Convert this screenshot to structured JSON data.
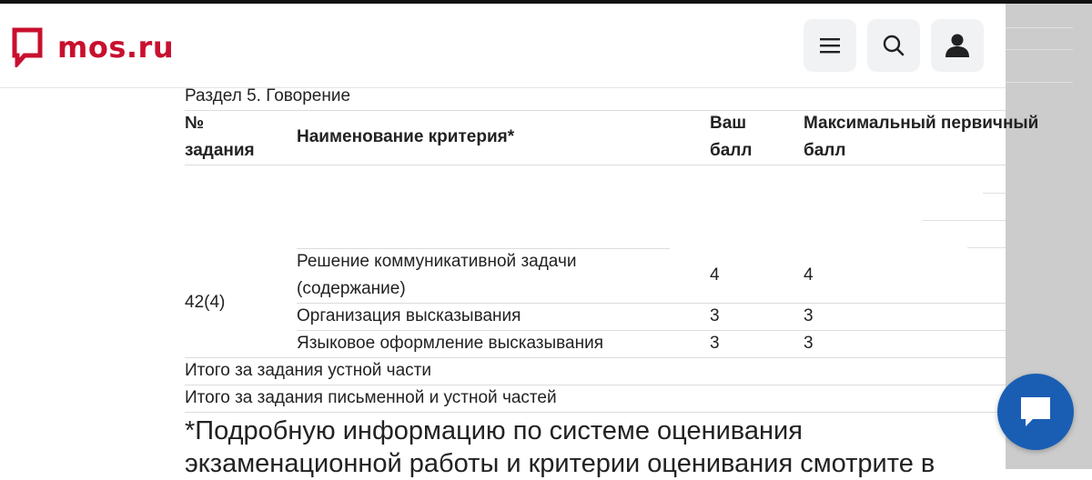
{
  "header": {
    "logo_text": "mos.ru",
    "brand_color": "#c8102e",
    "menu_icon": "menu-icon",
    "search_icon": "search-icon",
    "user_icon": "user-icon"
  },
  "table": {
    "section_title": "Раздел 5. Говорение",
    "headers": {
      "task_no_line1": "№",
      "task_no_line2": "задания",
      "criterion": "Наименование критерия*",
      "score_line1": "Ваш",
      "score_line2": "балл",
      "max_line1": "Максимальный первичный",
      "max_line2": "балл"
    },
    "task_id": "42(4)",
    "rows": [
      {
        "criterion_line1": "Решение коммуникативной задачи",
        "criterion_line2": "(содержание)",
        "score": "4",
        "max": "4"
      },
      {
        "criterion_line1": "Организация высказывания",
        "score": "3",
        "max": "3"
      },
      {
        "criterion_line1": "Языковое оформление высказывания",
        "score": "3",
        "max": "3"
      }
    ],
    "totals": {
      "oral": "Итого за задания устной части",
      "written_oral": "Итого за задания письменной и устной частей"
    }
  },
  "footnote": {
    "line1": "*Подробную информацию по системе оценивания",
    "line2": "экзаменационной работы и критерии оценивания смотрите в"
  },
  "chat": {
    "icon": "chat-icon",
    "color": "#1a5eb4"
  }
}
